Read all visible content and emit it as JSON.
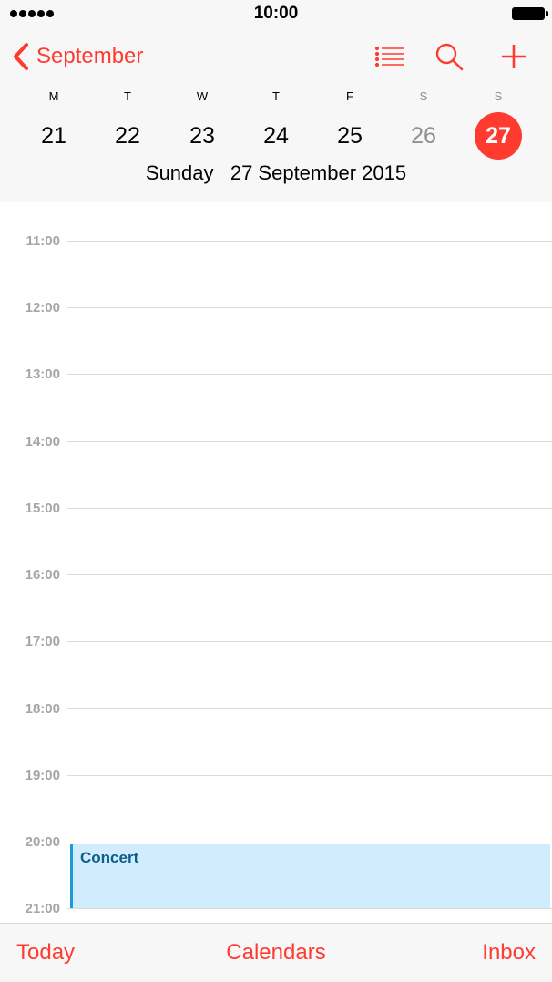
{
  "status_bar": {
    "time": "10:00",
    "signal_bars": 5
  },
  "nav": {
    "back_label": "September",
    "icons": [
      "list-icon",
      "search-icon",
      "add-icon"
    ],
    "accent_color": "#ff3b30"
  },
  "week": {
    "weekdays": [
      "M",
      "T",
      "W",
      "T",
      "F",
      "S",
      "S"
    ],
    "dates": [
      "21",
      "22",
      "23",
      "24",
      "25",
      "26",
      "27"
    ],
    "selected_index": 6,
    "full_date": "Sunday   27 September 2015"
  },
  "timeline": {
    "hours": [
      "11:00",
      "12:00",
      "13:00",
      "14:00",
      "15:00",
      "16:00",
      "17:00",
      "18:00",
      "19:00",
      "20:00",
      "21:00"
    ],
    "events": [
      {
        "title": "Concert",
        "start": "20:00",
        "end": "21:00",
        "color": "#1c9ad8"
      }
    ]
  },
  "tab_bar": {
    "today_label": "Today",
    "calendars_label": "Calendars",
    "inbox_label": "Inbox"
  }
}
